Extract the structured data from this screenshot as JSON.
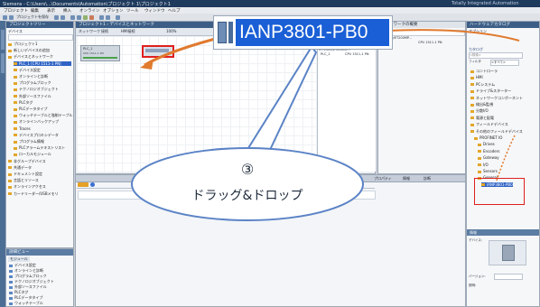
{
  "app": {
    "title": "Siemens - C:\\Users\\...\\Documents\\Automation\\プロジェクト 1\\プロジェクト1",
    "brand": "Totally Integrated Automation"
  },
  "menu": [
    "プロジェクト",
    "編集",
    "表示",
    "挿入",
    "オンライン",
    "オプション",
    "ツール",
    "ウィンドウ",
    "ヘルプ"
  ],
  "toolbar": {
    "open_project": "プロジェクトを保存"
  },
  "project_tree": {
    "header": "プロジェクトツリー",
    "subheader": "デバイス",
    "items": [
      {
        "label": "プロジェクト1",
        "selected": false
      },
      {
        "label": "新しいデバイスの追加",
        "selected": false
      },
      {
        "label": "デバイスとネットワーク",
        "selected": false
      },
      {
        "label": "PLC_1 [CPU 1511-1 PN]",
        "selected": true
      },
      {
        "label": "デバイス設定",
        "selected": false
      },
      {
        "label": "オンラインと診断",
        "selected": false
      },
      {
        "label": "プログラムブロック",
        "selected": false
      },
      {
        "label": "テクノロジオブジェクト",
        "selected": false
      },
      {
        "label": "外部ソースファイル",
        "selected": false
      },
      {
        "label": "PLCタグ",
        "selected": false
      },
      {
        "label": "PLCデータタイプ",
        "selected": false
      },
      {
        "label": "ウォッチテーブルと強制テーブル",
        "selected": false
      },
      {
        "label": "オンラインバックアップ",
        "selected": false
      },
      {
        "label": "Traces",
        "selected": false
      },
      {
        "label": "デバイスプロキシデータ",
        "selected": false
      },
      {
        "label": "プログラム情報",
        "selected": false
      },
      {
        "label": "PLCアラームテキストリスト",
        "selected": false
      },
      {
        "label": "ローカルモジュール",
        "selected": false
      },
      {
        "label": "非グループデバイス",
        "selected": false
      },
      {
        "label": "共通データ",
        "selected": false
      },
      {
        "label": "ドキュメント設定",
        "selected": false
      },
      {
        "label": "言語とリソース",
        "selected": false
      },
      {
        "label": "オンラインアクセス",
        "selected": false
      },
      {
        "label": "カードリーダー/USBメモリ",
        "selected": false
      }
    ],
    "details_header": "詳細ビュー",
    "details_tab": "モジュール",
    "details_items": [
      "デバイス設定",
      "オンラインと診断",
      "プログラムブロック",
      "テクノロジオブジェクト",
      "外部ソースファイル",
      "PLCタグ",
      "PLCデータタイプ",
      "ウォッチテーブル"
    ]
  },
  "editor": {
    "breadcrumb": "プロジェクト1 › デバイスとネットワーク",
    "tabs": [
      "トポロジビュー",
      "ネットワークビュー",
      "デバイスビュー"
    ],
    "view_buttons": [
      "ネットワーク",
      "接続",
      "HMI接続"
    ],
    "zoom": "100%",
    "plc_label": "PLC_1",
    "plc_sub": "CPU 1511-1 PN",
    "io_device_label": "IO device_1",
    "inspector_tabs": [
      "プロパティ",
      "情報",
      "診断"
    ],
    "overview_tabs": [
      "ネットワークの概要",
      "接続",
      "関係"
    ],
    "overview_cols": [
      "デバイス",
      "タイプ",
      "アドレス"
    ],
    "overview_rows": [
      [
        "S7-1500/ET200MP...",
        "S7-1500/ET200MP..."
      ],
      [
        "PLC_1",
        "CPU 1511-1 PN"
      ]
    ]
  },
  "catalog": {
    "header": "ハードウェアカタログ",
    "options": "オプション",
    "catalog_label": "カタログ",
    "search_placeholder": "<検索>",
    "filter": "フィルタ",
    "profile": "<すべて>",
    "items": [
      "コントローラ",
      "HMI",
      "PCシステム",
      "ドライブ&スターター",
      "ネットワークコンポーネント",
      "検出&監視",
      "分散I/O",
      "電源と配電",
      "フィールドデバイス",
      "その他のフィールドデバイス",
      "PROFINET IO",
      "Drives",
      "Encoders",
      "Gateway",
      "I/O",
      "Sensors",
      "General",
      "IANP3801-PB0"
    ],
    "info_header": "情報",
    "info_device_label": "デバイス:",
    "info_version_label": "バージョン:",
    "info_desc_label": "説明:"
  },
  "overlay": {
    "device_chip": "IANP3801-PB0",
    "step_number": "③",
    "step_text": "ドラッグ&ドロップ"
  },
  "colors": {
    "accent_orange": "#e07a2e",
    "highlight_red": "#e01f1f",
    "chip_blue": "#1a5fd6",
    "callout_fill": "#ffffff",
    "callout_stroke": "#5b83c6"
  }
}
